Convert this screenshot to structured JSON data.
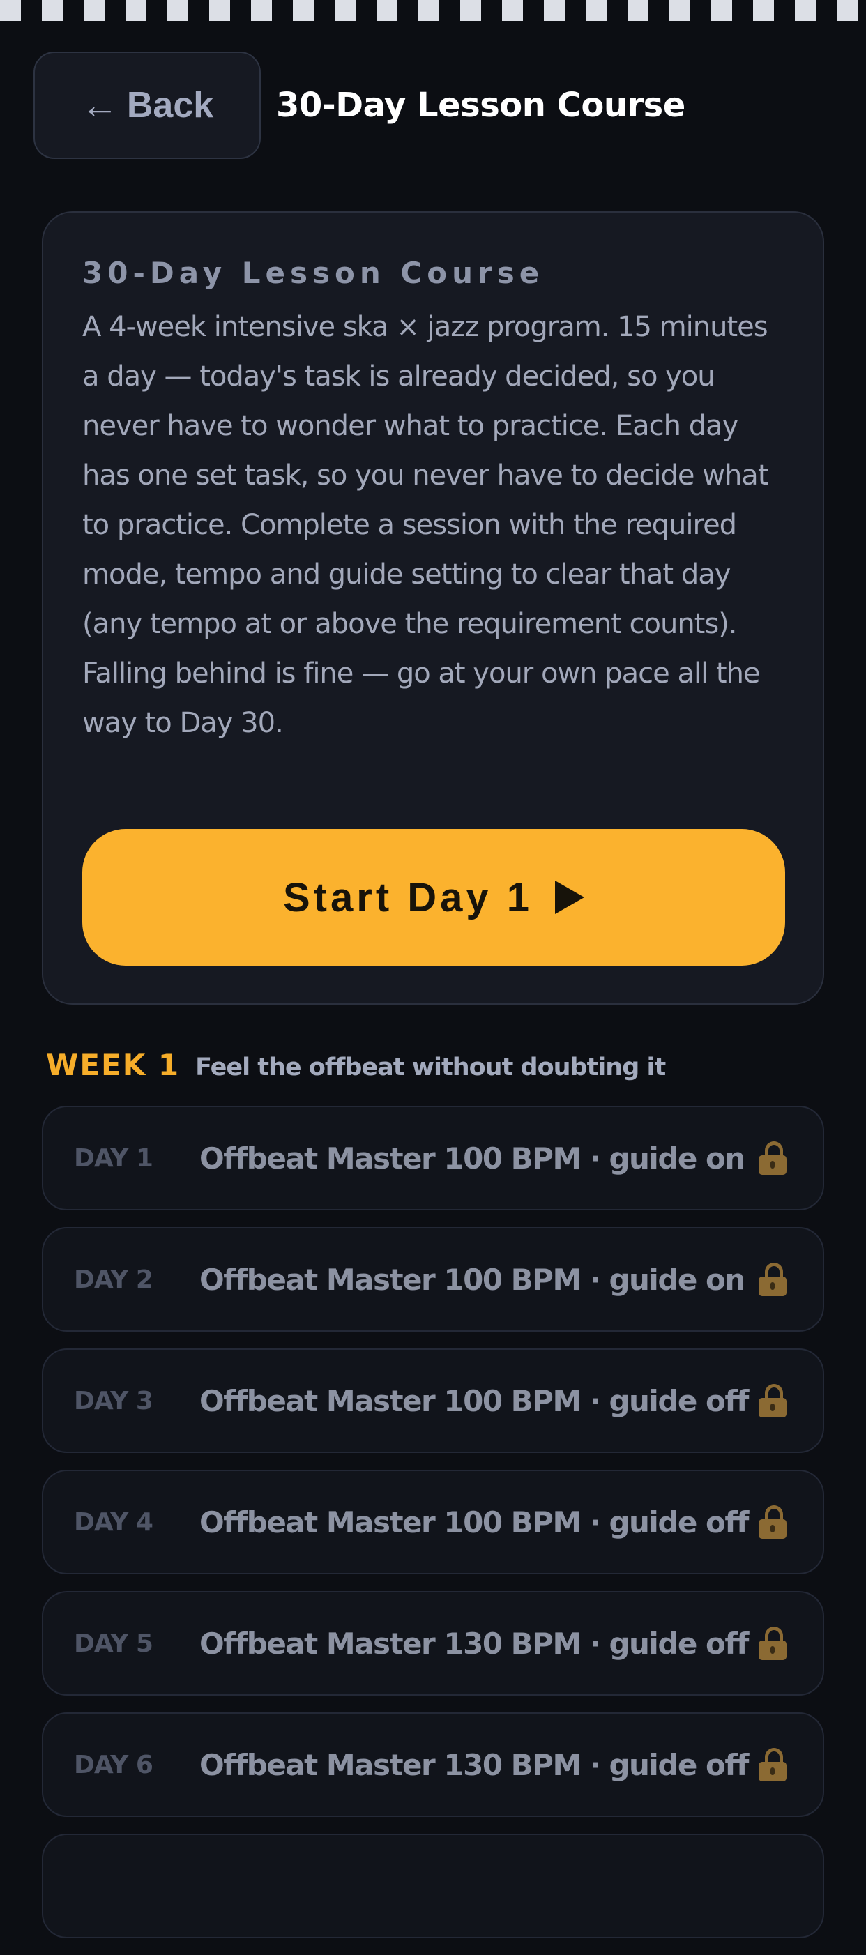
{
  "header": {
    "back_label": "Back",
    "title": "30-Day Lesson Course"
  },
  "intro": {
    "heading": "30-Day Lesson Course",
    "description": "A 4-week intensive ska × jazz program. 15 minutes a day — today's task is already decided, so you never have to wonder what to practice. Each day has one set task, so you never have to decide what to practice. Complete a session with the required mode, tempo and guide setting to clear that day (any tempo at or above the requirement counts). Falling behind is fine — go at your own pace all the way to Day 30.",
    "start_label": "Start Day 1"
  },
  "week1": {
    "label": "WEEK 1",
    "subtitle": "Feel the offbeat without doubting it",
    "days": [
      {
        "day": "DAY 1",
        "task": "Offbeat Master 100 BPM · guide on"
      },
      {
        "day": "DAY 2",
        "task": "Offbeat Master 100 BPM · guide on"
      },
      {
        "day": "DAY 3",
        "task": "Offbeat Master 100 BPM · guide off"
      },
      {
        "day": "DAY 4",
        "task": "Offbeat Master 100 BPM · guide off"
      },
      {
        "day": "DAY 5",
        "task": "Offbeat Master 130 BPM · guide off"
      },
      {
        "day": "DAY 6",
        "task": "Offbeat Master 130 BPM · guide off"
      },
      {
        "day": "",
        "task": ""
      }
    ]
  },
  "colors": {
    "background": "#0c0e13",
    "accent": "#fbb22e",
    "card": "#161922",
    "lock": "#8b6a33"
  },
  "icons": {
    "back": "left-arrow-icon",
    "start": "play-icon",
    "locked": "lock-icon"
  }
}
